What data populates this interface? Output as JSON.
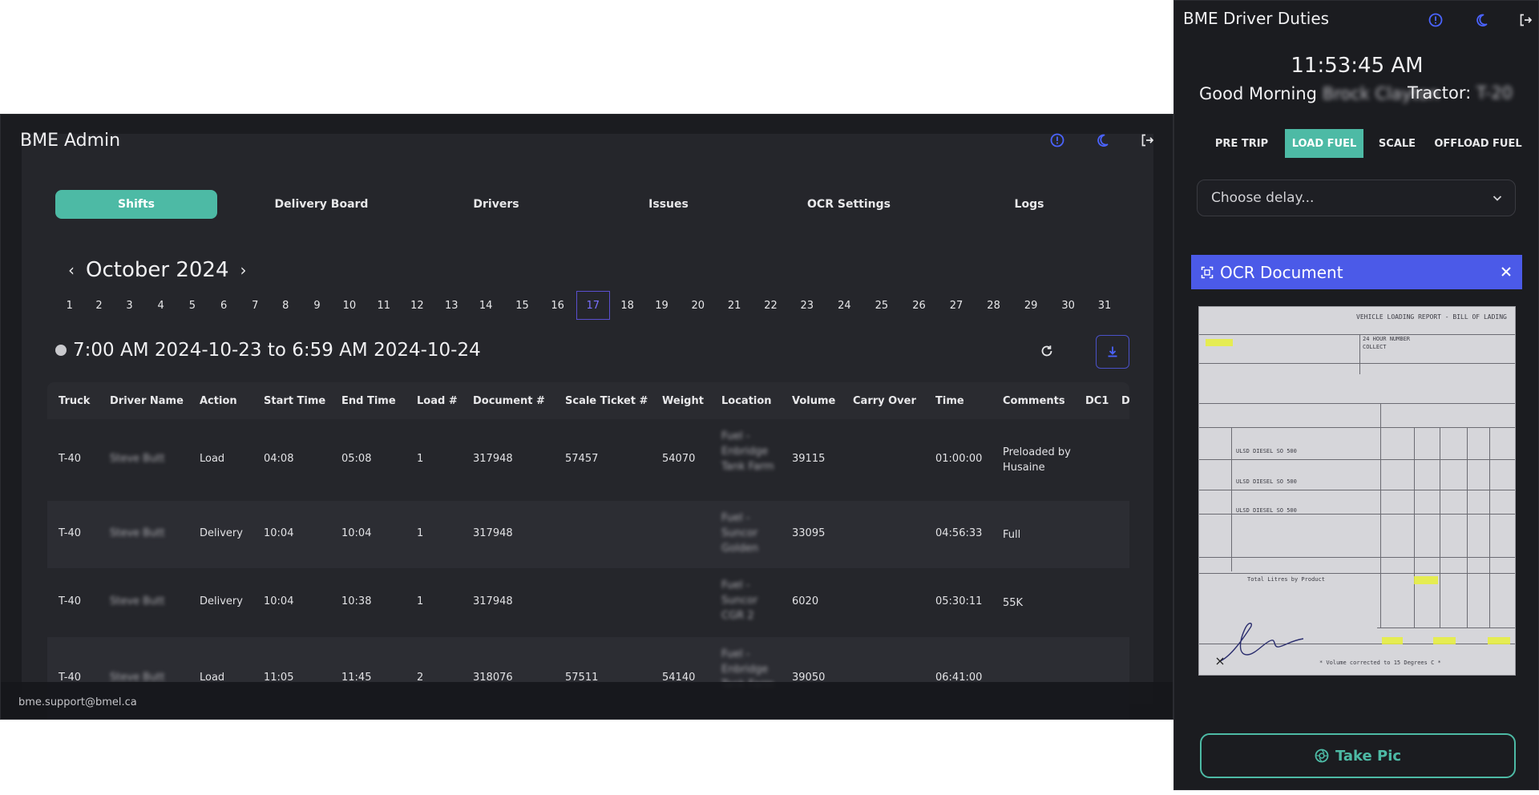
{
  "admin": {
    "title": "BME Admin",
    "tabs": [
      "Shifts",
      "Delivery Board",
      "Drivers",
      "Issues",
      "OCR Settings",
      "Logs"
    ],
    "active_tab": "Shifts",
    "month_label": "October 2024",
    "prev_arrow": "‹",
    "next_arrow": "›",
    "days": [
      "1",
      "2",
      "3",
      "4",
      "5",
      "6",
      "7",
      "8",
      "9",
      "10",
      "11",
      "12",
      "13",
      "14",
      "15",
      "16",
      "17",
      "18",
      "19",
      "20",
      "21",
      "22",
      "23",
      "24",
      "25",
      "26",
      "27",
      "28",
      "29",
      "30",
      "31"
    ],
    "selected_day": "17",
    "range": "7:00 AM 2024-10-23 to 6:59 AM 2024-10-24",
    "columns": [
      "Truck",
      "Driver Name",
      "Action",
      "Start Time",
      "End Time",
      "Load #",
      "Document #",
      "Scale Ticket #",
      "Weight",
      "Location",
      "Volume",
      "Carry Over",
      "Time",
      "Comments",
      "DC1",
      "D"
    ],
    "rows": [
      {
        "truck": "T-40",
        "driver": "Steve Butt",
        "action": "Load",
        "start": "04:08",
        "end": "05:08",
        "load": "1",
        "document": "317948",
        "scale": "57457",
        "weight": "54070",
        "location": "Fuel - Enbridge Tank Farm",
        "volume": "39115",
        "carry": "",
        "time": "01:00:00",
        "comments": "Preloaded by Husaine"
      },
      {
        "truck": "T-40",
        "driver": "Steve Butt",
        "action": "Delivery",
        "start": "10:04",
        "end": "10:04",
        "load": "1",
        "document": "317948",
        "scale": "",
        "weight": "",
        "location": "Fuel - Suncor Golden",
        "volume": "33095",
        "carry": "",
        "time": "04:56:33",
        "comments": "Full"
      },
      {
        "truck": "T-40",
        "driver": "Steve Butt",
        "action": "Delivery",
        "start": "10:04",
        "end": "10:38",
        "load": "1",
        "document": "317948",
        "scale": "",
        "weight": "",
        "location": "Fuel - Suncor CGR 2",
        "volume": "6020",
        "carry": "",
        "time": "05:30:11",
        "comments": "55K"
      },
      {
        "truck": "T-40",
        "driver": "Steve Butt",
        "action": "Load",
        "start": "11:05",
        "end": "11:45",
        "load": "2",
        "document": "318076",
        "scale": "57511",
        "weight": "54140",
        "location": "Fuel - Enbridge Tank Farm",
        "volume": "39050",
        "carry": "",
        "time": "06:41:00",
        "comments": ""
      }
    ],
    "footer_email": "bme.support@bmel.ca"
  },
  "driver": {
    "title": "BME Driver Duties",
    "clock": "11:53:45 AM",
    "greeting_prefix": "Good Morning",
    "greeting_name": "Brock Clayton",
    "tractor_label": "Tractor:",
    "tractor_value": "T-20",
    "stages": [
      "PRE TRIP",
      "LOAD FUEL",
      "SCALE",
      "OFFLOAD FUEL"
    ],
    "active_stage": "LOAD FUEL",
    "delay_placeholder": "Choose delay...",
    "ocr_title": "OCR Document",
    "doc_heading": "VEHICLE LOADING REPORT - BILL OF LADING",
    "doc_hours": "24 HOUR NUMBER",
    "doc_collect": "COLLECT",
    "doc_product_1": "ULSD DIESEL SO 500",
    "doc_product_2": "ULSD DIESEL SO 500",
    "doc_product_3": "ULSD DIESEL SO 500",
    "doc_total": "Total Litres by Product",
    "doc_footnote": "* Volume corrected to 15 Degrees C *",
    "take_pic": "Take Pic"
  },
  "colors": {
    "accent": "#4dbaa5",
    "ocr_bar": "#4b5ae8",
    "selected_day": "#5a4fcf",
    "icon_blue": "#4a63ff"
  }
}
